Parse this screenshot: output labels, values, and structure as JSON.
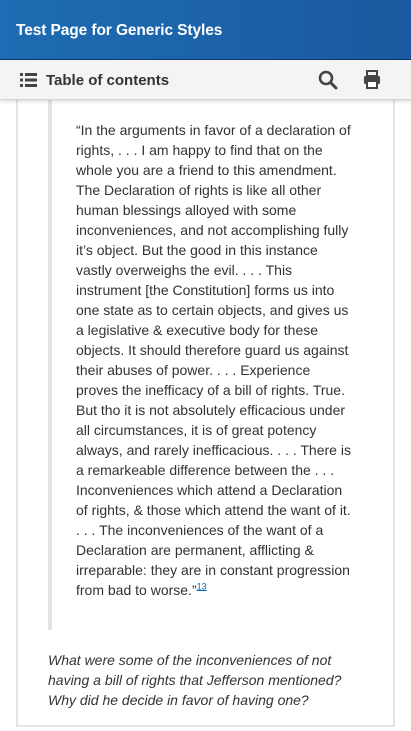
{
  "header": {
    "title": "Test Page for Generic Styles"
  },
  "toolbar": {
    "toc_label": "Table of contents",
    "icons": {
      "toc": "list-icon",
      "search": "search-icon",
      "print": "print-icon"
    }
  },
  "blockquote": {
    "text": "“In the arguments in favor of a declaration of rights, . . . I am happy to find that on the whole you are a friend to this amendment. The Declaration of rights is like all other human blessings alloyed with some inconveniences, and not accomplishing fully it’s object. But the good in this instance vastly overweighs the evil. . . . This instrument [the Constitution] forms us into one state as to certain objects, and gives us a legislative & executive body for these objects. It should therefore guard us against their abuses of power. . . . Experience proves the inefficacy of a bill of rights. True. But tho it is not absolutely efficacious under all circumstances, it is of great potency always, and rarely inefficacious. . . . There is a remarkeable difference between the . . . Inconveniences which attend a Declaration of rights, & those which attend the want of it. . . . The inconveniences of the want of a Declaration are permanent, afflicting & irreparable: they are in constant progression from bad to worse.”",
    "footnote": "13"
  },
  "question": "What were some of the inconveniences of not having a bill of rights that Jefferson mentioned? Why did he decide in favor of having one?",
  "colors": {
    "header_bg": "#1a5aa0",
    "link": "#0b64b8",
    "text": "#333333"
  }
}
